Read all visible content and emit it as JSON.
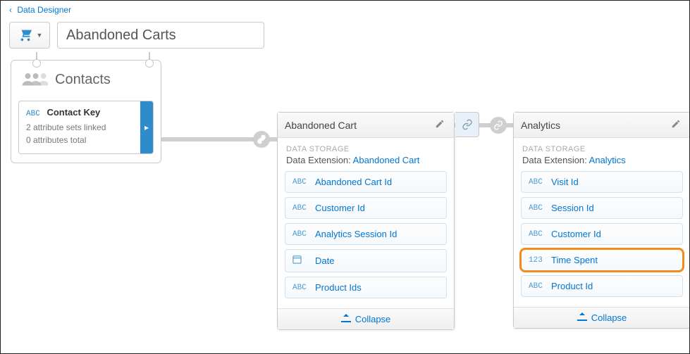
{
  "breadcrumb": {
    "label": "Data Designer"
  },
  "header": {
    "title": "Abandoned Carts"
  },
  "contacts": {
    "title": "Contacts",
    "key_card": {
      "type_prefix": "ABC",
      "title": "Contact Key",
      "line1": "2 attribute sets linked",
      "line2": "0 attributes total"
    }
  },
  "groups": [
    {
      "title": "Abandoned Cart",
      "section_label": "DATA STORAGE",
      "extension_prefix": "Data Extension: ",
      "extension_link": "Abandoned Cart",
      "collapse_label": "Collapse",
      "attributes": [
        {
          "type": "ABC",
          "label": "Abandoned Cart Id",
          "highlight": false
        },
        {
          "type": "ABC",
          "label": "Customer Id",
          "highlight": false
        },
        {
          "type": "ABC",
          "label": "Analytics Session Id",
          "highlight": false
        },
        {
          "type": "DATE",
          "label": "Date",
          "highlight": false
        },
        {
          "type": "ABC",
          "label": "Product Ids",
          "highlight": false
        }
      ]
    },
    {
      "title": "Analytics",
      "section_label": "DATA STORAGE",
      "extension_prefix": "Data Extension: ",
      "extension_link": "Analytics",
      "collapse_label": "Collapse",
      "attributes": [
        {
          "type": "ABC",
          "label": "Visit Id",
          "highlight": false
        },
        {
          "type": "ABC",
          "label": "Session Id",
          "highlight": false
        },
        {
          "type": "ABC",
          "label": "Customer Id",
          "highlight": false
        },
        {
          "type": "123",
          "label": "Time Spent",
          "highlight": true
        },
        {
          "type": "ABC",
          "label": "Product Id",
          "highlight": false
        }
      ]
    }
  ]
}
